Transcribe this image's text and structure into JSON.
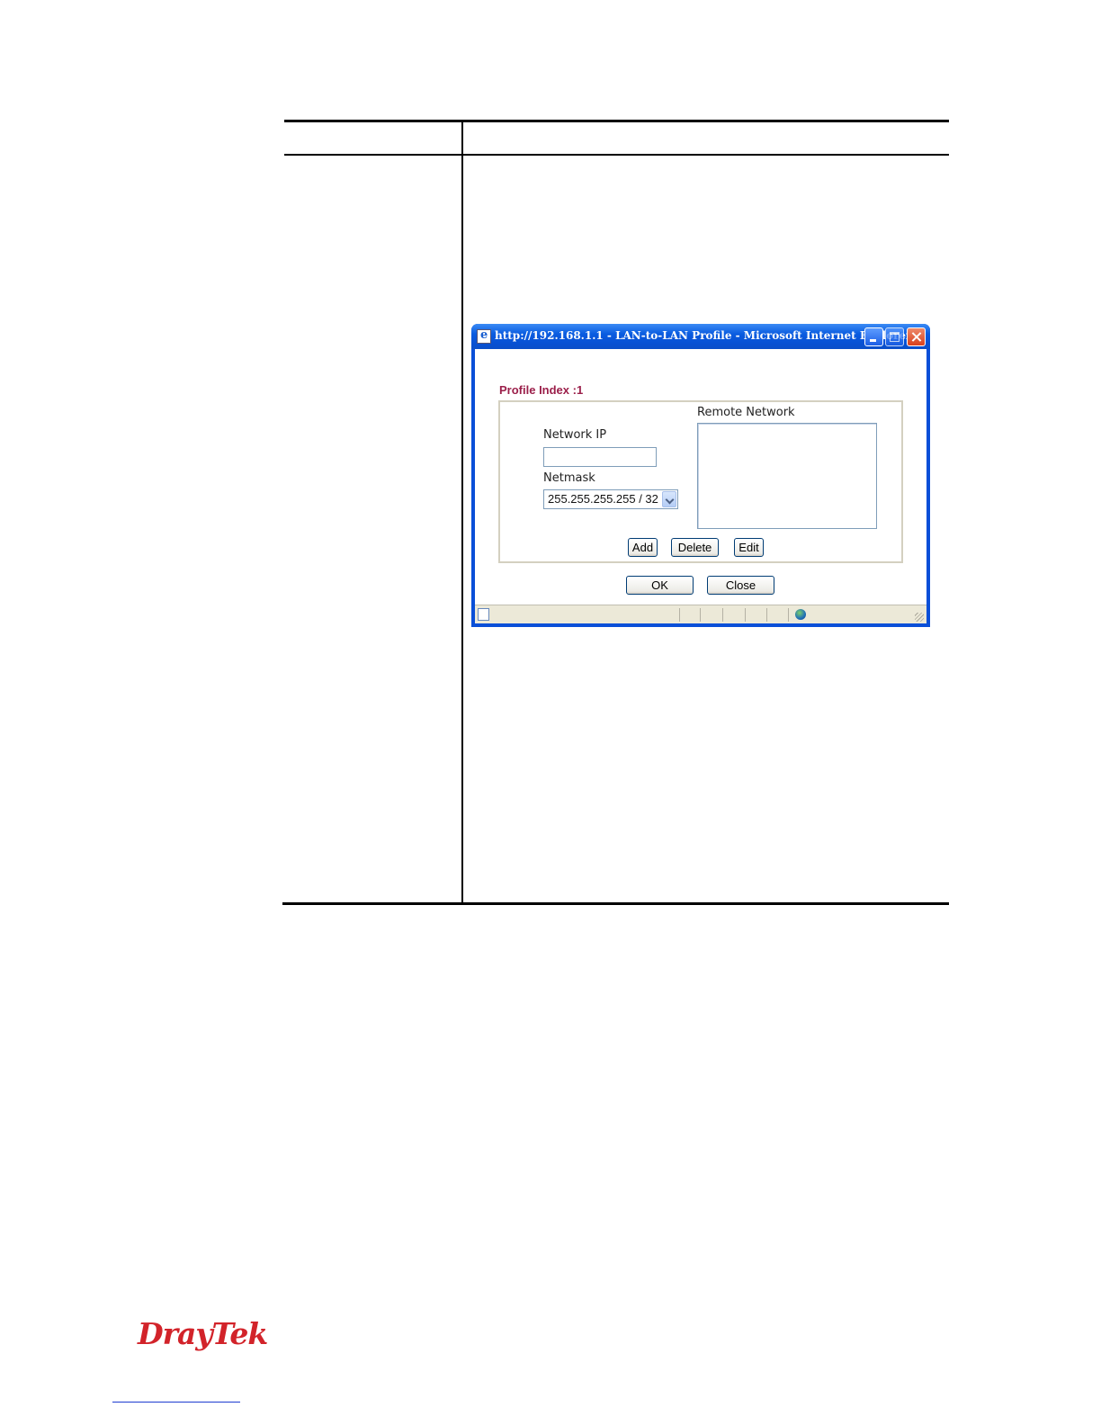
{
  "ie_window": {
    "title": "http://192.168.1.1 - LAN-to-LAN Profile - Microsoft Internet Explorer",
    "icon": "ie-page-icon",
    "controls": [
      "minimize-icon",
      "maximize-icon",
      "close-icon"
    ]
  },
  "dialog": {
    "profile_index": "Profile Index :1",
    "remote_network_label": "Remote Network",
    "network_ip_label": "Network IP",
    "network_ip_value": "",
    "netmask_label": "Netmask",
    "netmask_value": "255.255.255.255 / 32",
    "buttons": {
      "add": "Add",
      "delete": "Delete",
      "edit": "Edit",
      "ok": "OK",
      "close": "Close"
    }
  },
  "status_bar": {
    "icons": [
      "page-icon",
      "internet-zone-icon",
      "resize-grip-icon"
    ]
  },
  "logo": {
    "text": "DrayTek",
    "color": "#d2232a"
  }
}
